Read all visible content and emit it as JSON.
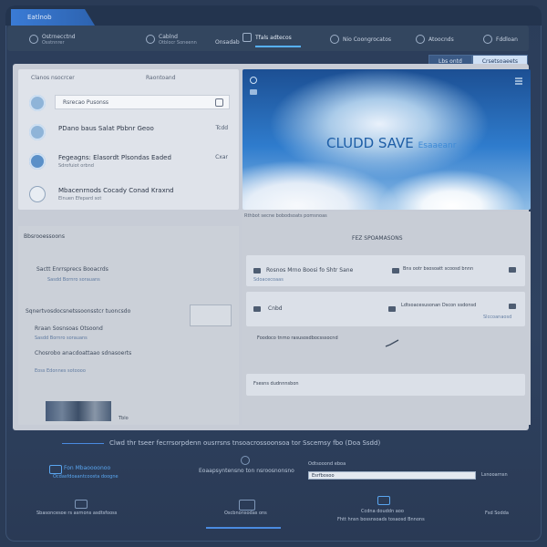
{
  "app": {
    "tab_label": "Eatlnob"
  },
  "nav": [
    {
      "label": "Ostrnecctnd",
      "sub": "Osstnnrer"
    },
    {
      "label": "Cablnd",
      "sub": "Otblocr Soneenn"
    },
    {
      "label": "Onsadab",
      "sub": ""
    },
    {
      "label": "Tfals adtecos",
      "sub": ""
    },
    {
      "label": "Nio Coongrocatos",
      "sub": ""
    },
    {
      "label": "Atoocnds",
      "sub": ""
    },
    {
      "label": "Fddloan",
      "sub": ""
    }
  ],
  "pills": [
    "Lbs ontd",
    "Crsetsoaeets"
  ],
  "list": {
    "header_left": "Clanos nsocrcer",
    "header_right": "Raontoand",
    "search": "Rsrecao Pusonss",
    "rows": [
      {
        "title": "PDano baus Salat Pbbnr Geoo",
        "sub": "",
        "right": "Tcdd"
      },
      {
        "title": "Fegeagns: Elasordt Plsondas Eaded",
        "sub": "Sdrofuiot orbnd",
        "right": "Cxar"
      },
      {
        "title": "Mbacenrnods Cocady Conad Kraxnd",
        "sub": "Elnuen Efepard sot",
        "right": ""
      }
    ]
  },
  "hero": {
    "title_a": "CLUDD SAVE",
    "title_b": "Esaaeanr"
  },
  "lower_left": {
    "heading": "Bbsrooessoons",
    "item1": "Sactt Enrrsprecs Booacrds",
    "item1_sub": "Sasdd Bornro sorauans",
    "item2": "Sqnertvosdocsnetssoonsstcr tuoncsdo",
    "item3": "Rraan Sosnsoas Otsoond",
    "item3_sub": "Sasdd Bornro sorauans",
    "item4": "Chosrobo anacdoattaao sdnasoerts",
    "item4_sub": "Eoss Edonnes sotoooo",
    "link": "Tblo"
  },
  "lower_right": {
    "top": "Rthbot secne bobodsoats pomsnoas",
    "title": "FEZ SPOAMASONS",
    "card1_a": "Rosnos Mrno Boosi fo Shtr Sane",
    "card1_b": "Bns ootr bsosoatt scoosd bnnn",
    "card1_sub": "Sdoacecoaas",
    "card2_a": "Cnbd",
    "card2_b": "Ldtsoacesusonan Dscon ssdonsd",
    "card2_sub": "Slccoanaosd",
    "card3": "Foodoco tnrno rasusosdbocsssocnd",
    "card4": "Fsesns dudnnnsbon"
  },
  "footer": {
    "line": "Clwd thr tseer fecrrsorpdenn ousrrsns tnsoacrossoonsoa tor Sscemsy fbo (Doa Ssdd)",
    "left_link": "Fon Mbaoooonoo",
    "left_sub": "Ocdasfdoaantcoosta doogne",
    "center": "Eoaapsyntensno ton nsroosnonsno",
    "right_label": "Odtsooond eboa",
    "input_value": "Esrfbosoo",
    "right_btn": "Lsnooarnsn",
    "b1": "Sbasoncesoe rs asrnons asdtsfooss",
    "b2": "Oscbnonsodas ons",
    "b3_a": "Ccdna douddn aoo",
    "b3_b": "Fhtt hnsn bossnsoads tosaosd Bnnons",
    "b4": "Fsd Sodda"
  }
}
